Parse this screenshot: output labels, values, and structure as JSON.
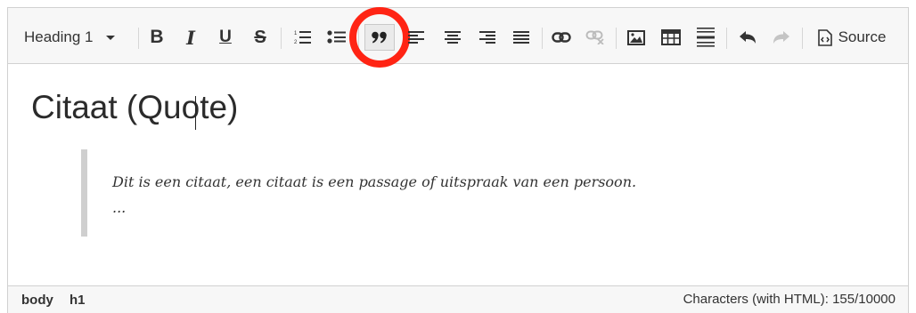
{
  "toolbar": {
    "format_select": "Heading 1",
    "source_label": "Source",
    "icons": [
      "bold-icon",
      "italic-icon",
      "underline-icon",
      "strikethrough-icon",
      "numbered-list-icon",
      "bullet-list-icon",
      "blockquote-icon",
      "align-left-icon",
      "align-center-icon",
      "align-right-icon",
      "align-justify-icon",
      "link-icon",
      "unlink-icon",
      "image-icon",
      "table-icon",
      "horizontal-rule-icon",
      "undo-icon",
      "redo-icon",
      "source-code-icon"
    ],
    "highlight_color": "#ff2414"
  },
  "content": {
    "heading": "Citaat (Quote)",
    "quote_line_1": "Dit is een citaat, een citaat is een passage of uitspraak van een persoon.",
    "quote_line_2": "..."
  },
  "statusbar": {
    "path_1": "body",
    "path_2": "h1",
    "counter": "Characters (with HTML): 155/10000"
  }
}
